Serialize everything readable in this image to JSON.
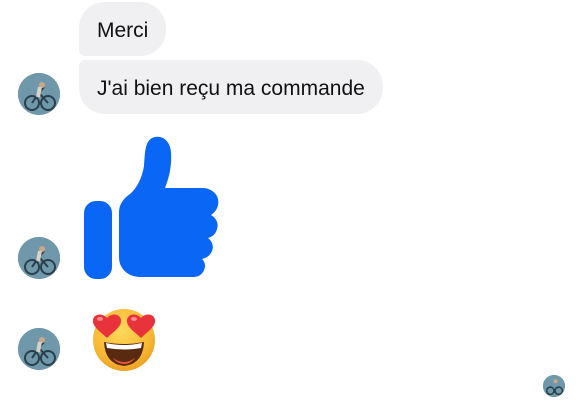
{
  "conversation": {
    "messages": [
      {
        "type": "text",
        "text": "Merci"
      },
      {
        "type": "text",
        "text": "J'ai bien reçu ma commande"
      },
      {
        "type": "sticker",
        "icon": "thumbs-up-icon",
        "color": "#0a66f5"
      },
      {
        "type": "emoji",
        "icon": "heart-eyes-emoji-icon"
      }
    ],
    "avatar_icon": "contact-avatar",
    "seen_indicator_icon": "seen-avatar"
  },
  "colors": {
    "bubble_bg": "#f0f0f2",
    "text": "#111111",
    "like_blue": "#0a66f5"
  }
}
